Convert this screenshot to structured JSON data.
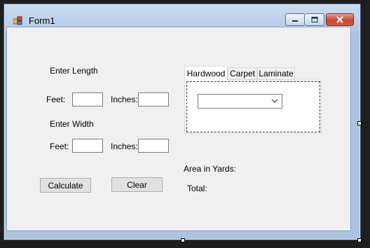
{
  "window": {
    "title": "Form1",
    "colors": {
      "titlebar": "#b9cfe8",
      "close": "#c8452f"
    }
  },
  "length": {
    "heading": "Enter Length",
    "feet_label": "Feet:",
    "inches_label": "Inches:",
    "feet_value": "",
    "inches_value": ""
  },
  "width": {
    "heading": "Enter Width",
    "feet_label": "Feet:",
    "inches_label": "Inches:",
    "feet_value": "",
    "inches_value": ""
  },
  "buttons": {
    "calculate": "Calculate",
    "clear": "Clear"
  },
  "tabs": [
    {
      "label": "Hardwood",
      "active": true
    },
    {
      "label": "Carpet",
      "active": false
    },
    {
      "label": "Laminate",
      "active": false
    }
  ],
  "hardwood_combo": {
    "selected": ""
  },
  "results": {
    "area_label": "Area in Yards:",
    "total_label": "Total:"
  },
  "icons": {
    "app": "form-app-icon",
    "minimize": "minimize-icon",
    "maximize": "maximize-icon",
    "close": "close-icon",
    "dropdown": "chevron-down-icon"
  }
}
